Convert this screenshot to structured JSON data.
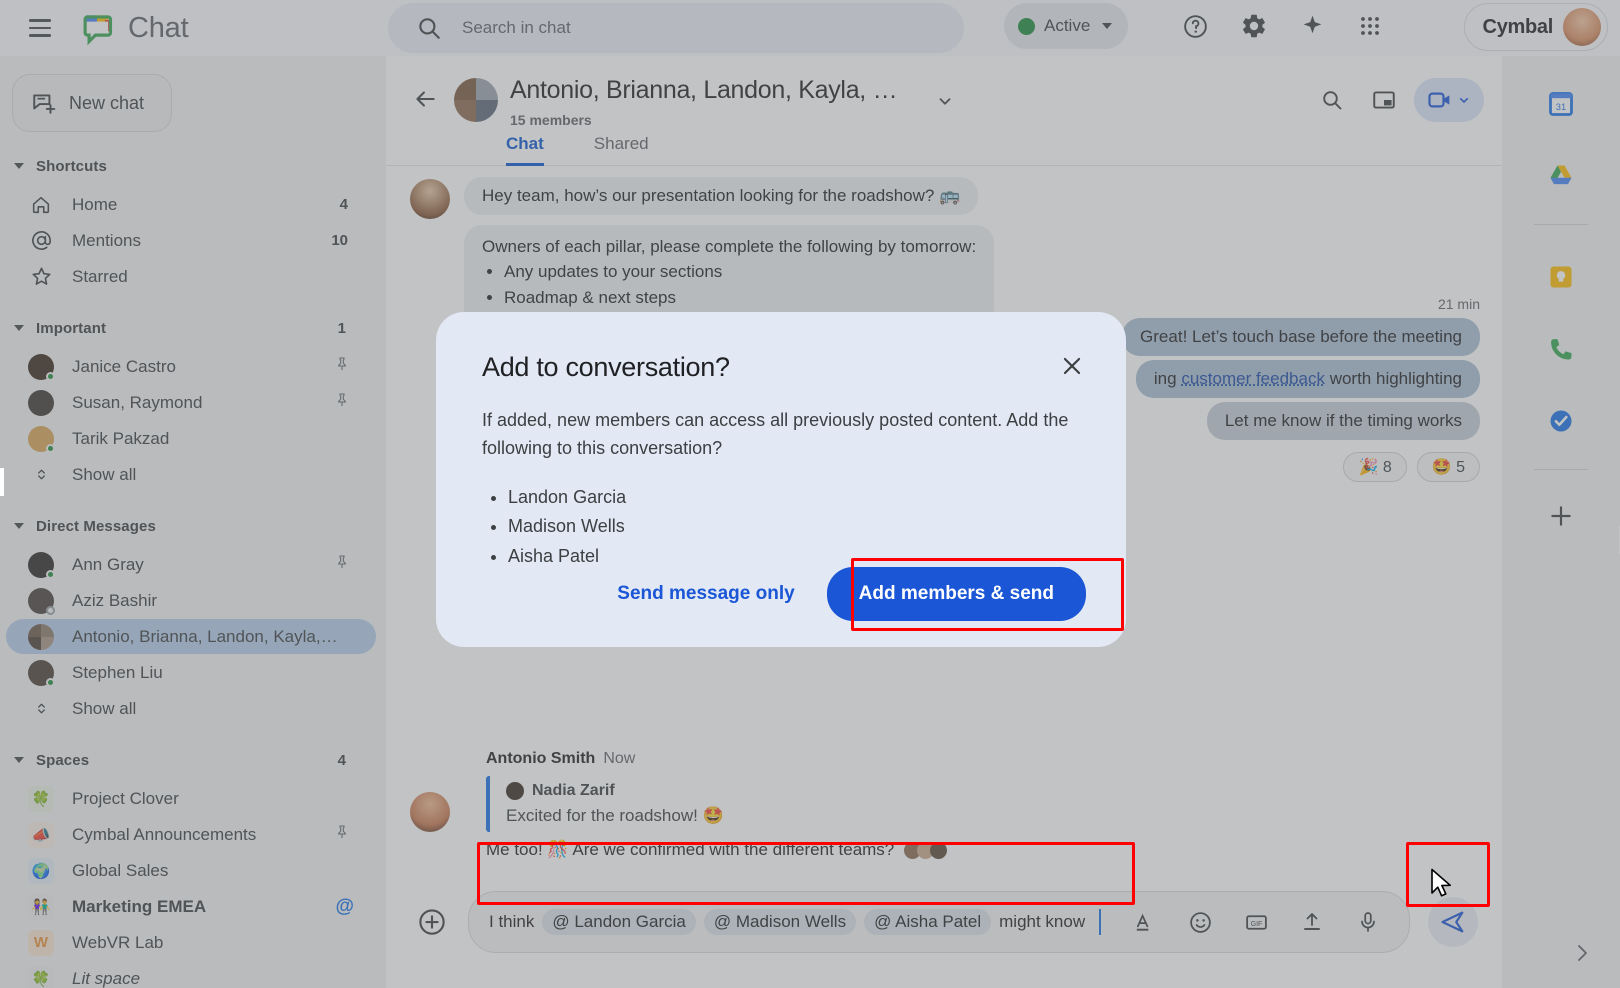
{
  "topbar": {
    "app_title": "Chat",
    "menu_icon": "hamburger-icon",
    "search_placeholder": "Search in chat",
    "status_label": "Active",
    "help_icon": "help-icon",
    "settings_icon": "gear-icon",
    "gemini_icon": "sparkle-icon",
    "apps_icon": "apps-grid-icon",
    "brand": "Cymbal"
  },
  "sidebar": {
    "new_chat_label": "New chat",
    "sections": [
      {
        "title": "Shortcuts",
        "count": "",
        "items": [
          {
            "label": "Home",
            "icon": "home-icon",
            "badge": "4",
            "type": "shortcut"
          },
          {
            "label": "Mentions",
            "icon": "at-icon",
            "badge": "10",
            "type": "shortcut"
          },
          {
            "label": "Starred",
            "icon": "star-icon",
            "badge": "",
            "type": "shortcut"
          }
        ]
      },
      {
        "title": "Important",
        "count": "1",
        "items": [
          {
            "label": "Janice Castro",
            "icon": "avatar",
            "pin": true,
            "presence": "on",
            "color": "#3a2a1e"
          },
          {
            "label": "Susan, Raymond",
            "icon": "avatar",
            "pin": true,
            "presence": "none",
            "color": "#3f3a34"
          },
          {
            "label": "Tarik Pakzad",
            "icon": "avatar",
            "pin": false,
            "presence": "on",
            "color": "#d8a657"
          },
          {
            "label": "Show all",
            "icon": "expand-icon",
            "pin": false,
            "presence": "none",
            "color": ""
          }
        ]
      },
      {
        "title": "Direct Messages",
        "count": "",
        "items": [
          {
            "label": "Ann Gray",
            "icon": "avatar",
            "pin": true,
            "presence": "on",
            "color": "#2e2a28"
          },
          {
            "label": "Aziz Bashir",
            "icon": "avatar",
            "pin": false,
            "presence": "off",
            "color": "#4a4340"
          },
          {
            "label": "Antonio, Brianna, Landon, Kayla, Jo...",
            "icon": "group-avatar",
            "pin": false,
            "presence": "none",
            "selected": true,
            "color": "#6b5a4a"
          },
          {
            "label": "Stephen Liu",
            "icon": "avatar",
            "pin": false,
            "presence": "on",
            "color": "#4b4036"
          },
          {
            "label": "Show all",
            "icon": "expand-icon",
            "pin": false,
            "presence": "none",
            "color": ""
          }
        ]
      },
      {
        "title": "Spaces",
        "count": "4",
        "items": [
          {
            "label": "Project Clover",
            "icon": "clover-emoji",
            "glyph": "🍀",
            "bg": "#e8f0e6"
          },
          {
            "label": "Cymbal Announcements",
            "icon": "megaphone-emoji",
            "glyph": "📣",
            "bg": "#f6ece2",
            "pin": true
          },
          {
            "label": "Global Sales",
            "icon": "globe-emoji",
            "glyph": "🌍",
            "bg": "#e4ecf7"
          },
          {
            "label": "Marketing EMEA",
            "icon": "people-emoji",
            "glyph": "👫",
            "bg": "#eceef0",
            "bold": true,
            "mention": true
          },
          {
            "label": "WebVR Lab",
            "icon": "letter-w-avatar",
            "glyph": "W",
            "bg": "#f8e6d2"
          },
          {
            "label": "Lit space",
            "icon": "clover-emoji",
            "glyph": "🍀",
            "bg": "#eceef0",
            "italic": true
          }
        ]
      }
    ]
  },
  "conversation": {
    "title": "Antonio, Brianna, Landon, Kayla, …",
    "members": "15 members",
    "tabs": [
      {
        "label": "Chat",
        "active": true
      },
      {
        "label": "Shared",
        "active": false
      }
    ],
    "header_icons": [
      "search-icon",
      "picture-in-picture-icon",
      "video-call-icon",
      "chevron-down-icon"
    ],
    "messages": [
      {
        "side": "left",
        "text": "Hey team, how’s our presentation looking for the roadshow? 🚌",
        "avatar": true
      },
      {
        "side": "left",
        "text": "Owners of each pillar, please complete the following by tomorrow:",
        "bullets": [
          "Any updates to your sections",
          "Roadmap & next steps"
        ]
      }
    ],
    "right_thread": {
      "timestamp": "21 min",
      "bubbles": [
        {
          "text": "Great! Let’s touch base before the meeting",
          "style": "blue"
        },
        {
          "text_pre": "ing ",
          "link": "customer feedback",
          "text_post": " worth highlighting",
          "style": "blue-link"
        },
        {
          "text": "Let me know if the timing works",
          "style": "grey"
        }
      ],
      "reactions": [
        {
          "emoji": "🎉",
          "count": "8"
        },
        {
          "emoji": "🤩",
          "count": "5"
        }
      ]
    },
    "lower": {
      "sender_name": "Antonio Smith",
      "sender_time": "Now",
      "quote_author": "Nadia Zarif",
      "quote_text": "Excited for the roadshow! 🤩",
      "last_message": "Me too! 🎊 Are we confirmed with the different teams?"
    }
  },
  "composer": {
    "add_icon": "plus-circle-icon",
    "text_before": "I think",
    "mentions": [
      "@ Landon Garcia",
      "@ Madison Wells",
      "@ Aisha Patel"
    ],
    "text_after": "might know",
    "icons": [
      "format-text-icon",
      "emoji-icon",
      "gif-icon",
      "upload-icon",
      "microphone-icon"
    ],
    "send_icon": "send-icon"
  },
  "modal": {
    "title": "Add to conversation?",
    "body": "If added, new members can access all previously posted content. Add the following to this conversation?",
    "members": [
      "Landon Garcia",
      "Madison Wells",
      "Aisha Patel"
    ],
    "secondary_button": "Send message only",
    "primary_button": "Add members & send",
    "close_icon": "close-icon",
    "accent_color": "#1a56d6",
    "bg_color": "#e2e9f4"
  },
  "rail": {
    "icons": [
      "google-calendar-icon",
      "google-drive-icon",
      "google-keep-icon",
      "google-voice-icon",
      "google-tasks-icon",
      "add-apps-icon"
    ],
    "expand_icon": "chevron-right-icon"
  },
  "highlights": {
    "color": "#ff0000",
    "boxes": [
      "add-members-send-button",
      "message-input",
      "send-button"
    ]
  }
}
